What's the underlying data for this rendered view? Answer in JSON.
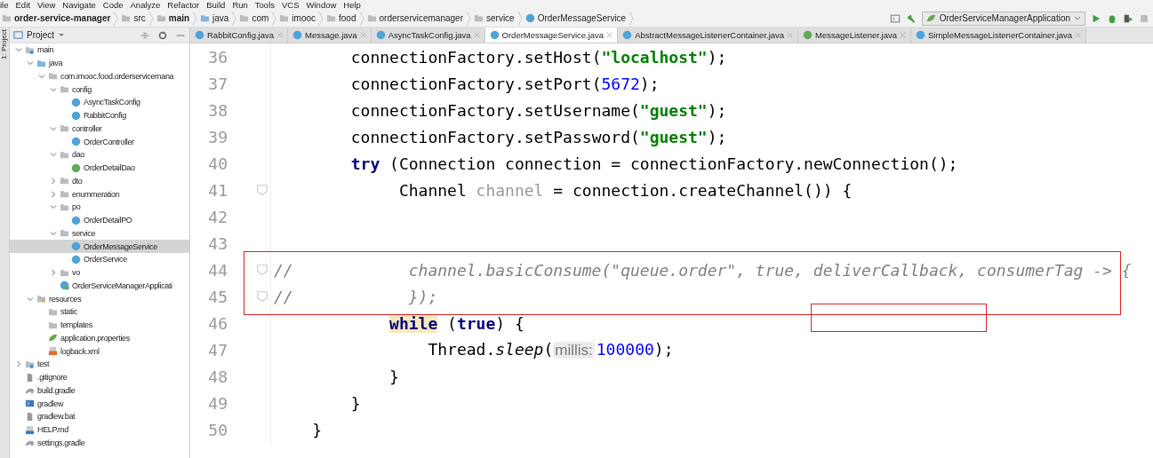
{
  "menu": [
    "ile",
    "Edit",
    "View",
    "Navigate",
    "Code",
    "Analyze",
    "Refactor",
    "Build",
    "Run",
    "Tools",
    "VCS",
    "Window",
    "Help"
  ],
  "breadcrumbs": [
    {
      "label": "order-service-manager",
      "kind": "module",
      "bold": true
    },
    {
      "label": "src",
      "kind": "folder",
      "bold": false
    },
    {
      "label": "main",
      "kind": "folder",
      "bold": true
    },
    {
      "label": "java",
      "kind": "source-folder",
      "bold": false
    },
    {
      "label": "com",
      "kind": "folder",
      "bold": false
    },
    {
      "label": "imooc",
      "kind": "folder",
      "bold": false
    },
    {
      "label": "food",
      "kind": "folder",
      "bold": false
    },
    {
      "label": "orderservicemanager",
      "kind": "folder",
      "bold": false
    },
    {
      "label": "service",
      "kind": "folder",
      "bold": false
    },
    {
      "label": "OrderMessageService",
      "kind": "class",
      "bold": false
    }
  ],
  "run_configuration": "OrderServiceManagerApplication",
  "tool_strip_label": "1: Project",
  "project_panel": {
    "title": "Project",
    "tree": [
      {
        "label": "main",
        "kind": "source-root",
        "expanded": true,
        "children": [
          {
            "label": "java",
            "kind": "source-folder",
            "expanded": true,
            "children": [
              {
                "label": "com.imooc.food.orderservicemana",
                "kind": "package",
                "expanded": true,
                "children": [
                  {
                    "label": "config",
                    "kind": "package",
                    "expanded": true,
                    "children": [
                      {
                        "label": "AsyncTaskConfig",
                        "kind": "class",
                        "selected": false
                      },
                      {
                        "label": "RabbitConfig",
                        "kind": "class",
                        "selected": false
                      }
                    ]
                  },
                  {
                    "label": "controller",
                    "kind": "package",
                    "expanded": true,
                    "children": [
                      {
                        "label": "OrderController",
                        "kind": "class",
                        "selected": false
                      }
                    ]
                  },
                  {
                    "label": "dao",
                    "kind": "package",
                    "expanded": true,
                    "children": [
                      {
                        "label": "OrderDetailDao",
                        "kind": "interface",
                        "selected": false
                      }
                    ]
                  },
                  {
                    "label": "dto",
                    "kind": "package",
                    "expanded": false
                  },
                  {
                    "label": "enummeration",
                    "kind": "package",
                    "expanded": false
                  },
                  {
                    "label": "po",
                    "kind": "package",
                    "expanded": true,
                    "children": [
                      {
                        "label": "OrderDetailPO",
                        "kind": "class",
                        "selected": false
                      }
                    ]
                  },
                  {
                    "label": "service",
                    "kind": "package",
                    "expanded": true,
                    "children": [
                      {
                        "label": "OrderMessageService",
                        "kind": "class",
                        "selected": true
                      },
                      {
                        "label": "OrderService",
                        "kind": "class",
                        "selected": false
                      }
                    ]
                  },
                  {
                    "label": "vo",
                    "kind": "package",
                    "expanded": false
                  },
                  {
                    "label": "OrderServiceManagerApplicati",
                    "kind": "spring-class",
                    "selected": false
                  }
                ]
              }
            ]
          },
          {
            "label": "resources",
            "kind": "resources-folder",
            "expanded": true,
            "children": [
              {
                "label": "static",
                "kind": "package",
                "selected": false
              },
              {
                "label": "templates",
                "kind": "package",
                "selected": false
              },
              {
                "label": "application.properties",
                "kind": "spring-properties",
                "selected": false
              },
              {
                "label": "logback.xml",
                "kind": "xml",
                "selected": false
              }
            ]
          }
        ]
      },
      {
        "label": "test",
        "kind": "test-root",
        "expanded": false
      },
      {
        "label": ".gitignore",
        "kind": "text-file",
        "selected": false
      },
      {
        "label": "build.gradle",
        "kind": "gradle",
        "selected": false
      },
      {
        "label": "gradlew",
        "kind": "shell",
        "selected": false
      },
      {
        "label": "gradlew.bat",
        "kind": "text-file",
        "selected": false
      },
      {
        "label": "HELP.md",
        "kind": "markdown",
        "selected": false
      },
      {
        "label": "settings.gradle",
        "kind": "gradle",
        "selected": false
      }
    ]
  },
  "tabs": [
    {
      "label": "RabbitConfig.java",
      "kind": "class",
      "selected": false
    },
    {
      "label": "Message.java",
      "kind": "class",
      "selected": false
    },
    {
      "label": "AsyncTaskConfig.java",
      "kind": "class",
      "selected": false
    },
    {
      "label": "OrderMessageService.java",
      "kind": "class",
      "selected": true
    },
    {
      "label": "AbstractMessageListenerContainer.java",
      "kind": "class",
      "selected": false
    },
    {
      "label": "MessageListener.java",
      "kind": "interface",
      "selected": false
    },
    {
      "label": "SimpleMessageListenerContainer.java",
      "kind": "class",
      "selected": false
    }
  ],
  "code_lines": [
    {
      "number": "36",
      "tokens": [
        {
          "kind": "plain",
          "text": "        connectionFactory.setHost("
        },
        {
          "kind": "string",
          "text": "\"localhost\""
        },
        {
          "kind": "plain",
          "text": ");"
        }
      ]
    },
    {
      "number": "37",
      "tokens": [
        {
          "kind": "plain",
          "text": "        connectionFactory.setPort("
        },
        {
          "kind": "number",
          "text": "5672"
        },
        {
          "kind": "plain",
          "text": ");"
        }
      ]
    },
    {
      "number": "38",
      "tokens": [
        {
          "kind": "plain",
          "text": "        connectionFactory.setUsername("
        },
        {
          "kind": "string",
          "text": "\"guest\""
        },
        {
          "kind": "plain",
          "text": ");"
        }
      ]
    },
    {
      "number": "39",
      "tokens": [
        {
          "kind": "plain",
          "text": "        connectionFactory.setPassword("
        },
        {
          "kind": "string",
          "text": "\"guest\""
        },
        {
          "kind": "plain",
          "text": ");"
        }
      ]
    },
    {
      "number": "40",
      "tokens": [
        {
          "kind": "keyword",
          "text": "        try"
        },
        {
          "kind": "plain",
          "text": " (Connection connection = connectionFactory.newConnection();"
        }
      ]
    },
    {
      "number": "41",
      "fold": true,
      "tokens": [
        {
          "kind": "plain",
          "text": "             Channel "
        },
        {
          "kind": "unused",
          "text": "channel"
        },
        {
          "kind": "plain",
          "text": " = connection.createChannel()) {"
        }
      ]
    },
    {
      "number": "42"
    },
    {
      "number": "43"
    },
    {
      "number": "44",
      "fold": true,
      "tokens": [
        {
          "kind": "comment",
          "text": "//            channel.basicConsume(\"queue.order\", true, deliverCallback, consumerTag -> {"
        }
      ]
    },
    {
      "number": "45",
      "fold": true,
      "tokens": [
        {
          "kind": "comment",
          "text": "//            });"
        }
      ]
    },
    {
      "number": "46",
      "tokens": [
        {
          "kind": "keyword-highlight",
          "text": "            while"
        },
        {
          "kind": "plain",
          "text": " ("
        },
        {
          "kind": "keyword",
          "text": "true"
        },
        {
          "kind": "plain",
          "text": ") {"
        }
      ]
    },
    {
      "number": "47",
      "tokens": [
        {
          "kind": "plain",
          "text": "                Thread."
        },
        {
          "kind": "static",
          "text": "sleep"
        },
        {
          "kind": "plain",
          "text": "("
        },
        {
          "kind": "hint",
          "text": "millis:"
        },
        {
          "kind": "number",
          "text": "100000"
        },
        {
          "kind": "plain",
          "text": ");"
        }
      ]
    },
    {
      "number": "48",
      "tokens": [
        {
          "kind": "plain",
          "text": "            }"
        }
      ]
    },
    {
      "number": "49",
      "tokens": [
        {
          "kind": "plain",
          "text": "        }"
        }
      ]
    },
    {
      "number": "50",
      "tokens": [
        {
          "kind": "plain",
          "text": "    }"
        }
      ]
    }
  ]
}
